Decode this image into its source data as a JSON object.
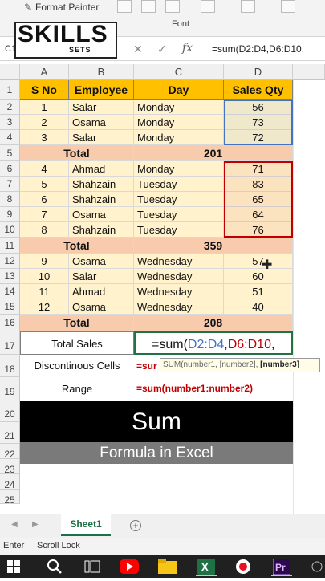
{
  "ribbon": {
    "format_painter": "Format Painter",
    "font_group": "Font",
    "brush_glyph": "✎"
  },
  "formula_bar": {
    "name_box": "C1",
    "cancel": "✕",
    "enter": "✓",
    "fx": "fx",
    "text": "=sum(D2:D4,D6:D10,"
  },
  "logo": {
    "main": "SKILLS",
    "sub": "SETS"
  },
  "columns": [
    "A",
    "B",
    "C",
    "D"
  ],
  "rows": [
    "1",
    "2",
    "3",
    "4",
    "5",
    "6",
    "7",
    "8",
    "9",
    "10",
    "11",
    "12",
    "13",
    "14",
    "15",
    "16",
    "17",
    "18",
    "19",
    "20",
    "21",
    "22",
    "23",
    "24",
    "25"
  ],
  "table": {
    "headers": [
      "S No",
      "Employee",
      "Day",
      "Sales Qty"
    ],
    "groups": [
      {
        "rows": [
          [
            "1",
            "Salar",
            "Monday",
            "56"
          ],
          [
            "2",
            "Osama",
            "Monday",
            "73"
          ],
          [
            "3",
            "Salar",
            "Monday",
            "72"
          ]
        ],
        "total_label": "Total",
        "total_value": "201"
      },
      {
        "rows": [
          [
            "4",
            "Ahmad",
            "Monday",
            "71"
          ],
          [
            "5",
            "Shahzain",
            "Tuesday",
            "83"
          ],
          [
            "6",
            "Shahzain",
            "Tuesday",
            "65"
          ],
          [
            "7",
            "Osama",
            "Tuesday",
            "64"
          ],
          [
            "8",
            "Shahzain",
            "Tuesday",
            "76"
          ]
        ],
        "total_label": "Total",
        "total_value": "359"
      },
      {
        "rows": [
          [
            "9",
            "Osama",
            "Wednesday",
            "57"
          ],
          [
            "10",
            "Salar",
            "Wednesday",
            "60"
          ],
          [
            "11",
            "Ahmad",
            "Wednesday",
            "51"
          ],
          [
            "12",
            "Osama",
            "Wednesday",
            "40"
          ]
        ],
        "total_label": "Total",
        "total_value": "208"
      }
    ]
  },
  "total_sales": {
    "label": "Total Sales",
    "formula_prefix": "=sum(",
    "ref1": "D2:D4",
    "comma1": ",",
    "ref2": "D6:D10",
    "comma2": ","
  },
  "tooltip": {
    "text": "SUM(number1, [number2], ",
    "bold": "[number3]"
  },
  "notes": [
    {
      "label": "Discontinous Cells",
      "formula": "=sur"
    },
    {
      "label": "Range",
      "formula": "=sum(number1:number2)"
    }
  ],
  "banner": {
    "line1": "Sum",
    "line2": "Formula in Excel"
  },
  "sheet_tab": {
    "label": "Sheet1",
    "add": "+"
  },
  "status": {
    "mode": "Enter",
    "scroll": "Scroll Lock"
  },
  "colors": {
    "header": "#ffc000",
    "row_fill": "#fff2cc",
    "total_fill": "#f8cbad",
    "ref1": "#4472c4",
    "ref2": "#c00000",
    "excel_green": "#1e7145"
  }
}
